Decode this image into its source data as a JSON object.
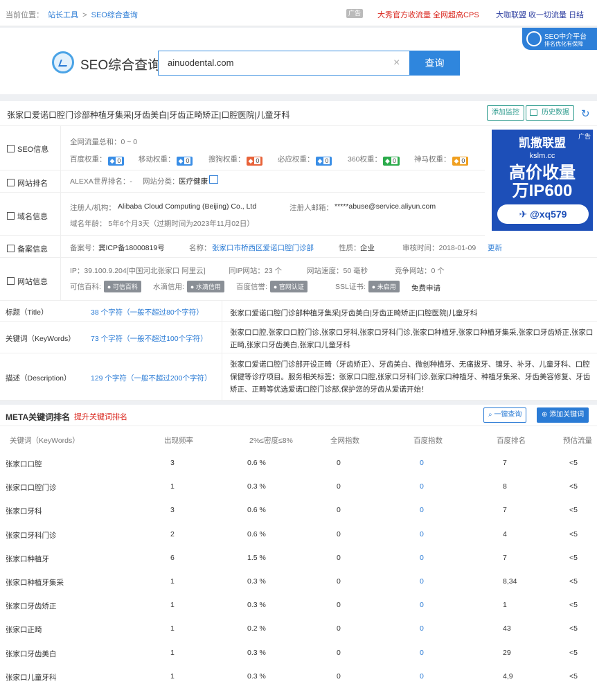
{
  "topbar": {
    "location_label": "当前位置：",
    "crumb1": "站长工具",
    "sep": ">",
    "crumb2": "SEO综合查询",
    "ad_tag": "广告",
    "ad1": "大秀官方收流量 全网超高CPS",
    "ad2": "大咖联盟 收一切流量 日结"
  },
  "badge": {
    "line1": "SEO中介平台",
    "line2": "排名优化有保障"
  },
  "search": {
    "logo_text": "SEO综合查询",
    "value": "ainuodental.com",
    "clear": "×",
    "button": "查询"
  },
  "site": {
    "title": "张家口爱诺口腔门诊部种植牙集采|牙齿美白|牙齿正畸矫正|口腔医院|儿童牙科",
    "btn_add": "添加监控",
    "btn_history": "历史数据"
  },
  "seo_info": {
    "label": "SEO信息",
    "traffic": "全网流量总和：0 ~ 0",
    "weights": [
      {
        "name": "百度权重：",
        "val": "0",
        "color": "#3a8ee6"
      },
      {
        "name": "移动权重：",
        "val": "0",
        "color": "#3a8ee6"
      },
      {
        "name": "搜狗权重：",
        "val": "0",
        "color": "#e8633a"
      },
      {
        "name": "必应权重：",
        "val": "0",
        "color": "#3a8ee6"
      },
      {
        "name": "360权重：",
        "val": "0",
        "color": "#2bab4b"
      },
      {
        "name": "神马权重：",
        "val": "0",
        "color": "#f0a020"
      }
    ]
  },
  "rank": {
    "label": "网站排名",
    "alexa": "ALEXA世界排名：-",
    "category_label": "网站分类：",
    "category": "医疗健康"
  },
  "domain": {
    "label": "域名信息",
    "registrant_label": "注册人/机构：",
    "registrant": "Alibaba Cloud Computing (Beijing) Co., Ltd",
    "email_label": "注册人邮箱：",
    "email": "*****abuse@service.aliyun.com",
    "age": "域名年龄： 5年6个月3天（过期时间为2023年11月02日）"
  },
  "icp": {
    "label": "备案信息",
    "no_label": "备案号：",
    "no": "冀ICP备18000819号",
    "name_label": "名称：",
    "name": "张家口市桥西区爱诺口腔门诊部",
    "nature_label": "性质：",
    "nature": "企业",
    "date": "审核时间：2018-01-09",
    "refresh": "更新"
  },
  "netinfo": {
    "label": "网站信息",
    "ip": "IP：39.100.9.204[中国河北张家口 阿里云]",
    "same_ip": "同IP网站：23 个",
    "speed": "网站速度：50 毫秒",
    "competitor": "竞争网站：0 个",
    "trust": [
      {
        "label": "可信百科:",
        "badge": "可信百科"
      },
      {
        "label": "水滴信用:",
        "badge": "水滴信用"
      },
      {
        "label": "百度信誉:",
        "badge": "官网认证"
      },
      {
        "label": "SSL证书:",
        "badge": "未启用"
      }
    ],
    "free": "免费申请"
  },
  "meta_rows": [
    {
      "name": "标题（Title）",
      "count": "38 个字符（一般不超过80个字符）",
      "content": "张家口爱诺口腔门诊部种植牙集采|牙齿美白|牙齿正畸矫正|口腔医院|儿童牙科"
    },
    {
      "name": "关键词（KeyWords）",
      "count": "73 个字符（一般不超过100个字符）",
      "content": "张家口口腔,张家口口腔门诊,张家口牙科,张家口牙科门诊,张家口种植牙,张家口种植牙集采,张家口牙齿矫正,张家口正畸,张家口牙齿美白,张家口儿童牙科"
    },
    {
      "name": "描述（Description）",
      "count": "129 个字符（一般不超过200个字符）",
      "content": "张家口爱诺口腔门诊部开设正畸（牙齿矫正）、牙齿美白、微创种植牙、无痛拔牙、镶牙、补牙、儿童牙科、口腔保健等诊疗项目。服务相关标签：张家口口腔,张家口牙科门诊,张家口种植牙、种植牙集采、牙齿美容修复、牙齿矫正、正畸等优选爱诺口腔门诊部,保护您的牙齿从爱诺开始！"
    }
  ],
  "ad_box": {
    "tag": "广告",
    "l1": "凯撒联盟",
    "l2": "kslm.cc",
    "l3": "高价收量",
    "l4": "万IP600",
    "l5": "@xq579"
  },
  "meta_kw": {
    "title": "META关键词排名",
    "subtitle": "提升关键词排名",
    "btn_query": "一键查询",
    "btn_add": "添加关键词",
    "headers": [
      "关键词（KeyWords）",
      "出现频率",
      "2%≤密度≤8%",
      "全网指数",
      "百度指数",
      "百度排名",
      "预估流量"
    ],
    "rows": [
      [
        "张家口口腔",
        "3",
        "0.6 %",
        "0",
        "0",
        "7",
        "<5"
      ],
      [
        "张家口口腔门诊",
        "1",
        "0.3 %",
        "0",
        "0",
        "8",
        "<5"
      ],
      [
        "张家口牙科",
        "3",
        "0.6 %",
        "0",
        "0",
        "7",
        "<5"
      ],
      [
        "张家口牙科门诊",
        "2",
        "0.6 %",
        "0",
        "0",
        "4",
        "<5"
      ],
      [
        "张家口种植牙",
        "6",
        "1.5 %",
        "0",
        "0",
        "7",
        "<5"
      ],
      [
        "张家口种植牙集采",
        "1",
        "0.3 %",
        "0",
        "0",
        "8,34",
        "<5"
      ],
      [
        "张家口牙齿矫正",
        "1",
        "0.3 %",
        "0",
        "0",
        "1",
        "<5"
      ],
      [
        "张家口正畸",
        "1",
        "0.2 %",
        "0",
        "0",
        "43",
        "<5"
      ],
      [
        "张家口牙齿美白",
        "1",
        "0.3 %",
        "0",
        "0",
        "29",
        "<5"
      ],
      [
        "张家口儿童牙科",
        "1",
        "0.3 %",
        "0",
        "0",
        "4,9",
        "<5"
      ]
    ]
  }
}
